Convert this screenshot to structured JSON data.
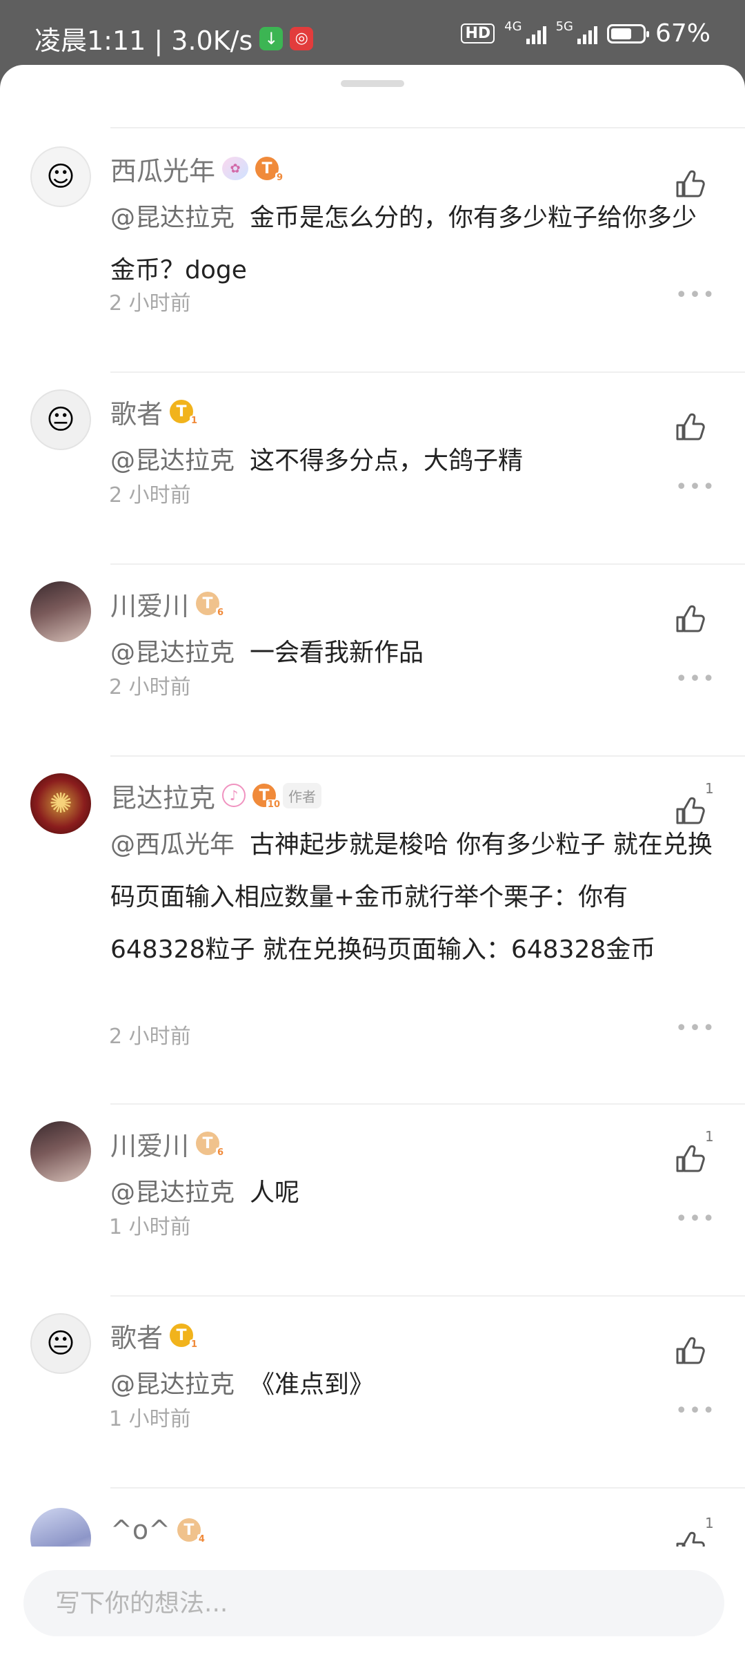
{
  "status_bar": {
    "time_speed": "凌晨1:11 | 3.0K/s",
    "hd_label": "HD",
    "net_4g": "4G",
    "net_5g": "5G",
    "battery": "67%",
    "battery_level": 0.67
  },
  "comments": [
    {
      "user": "西瓜光年",
      "level": "9",
      "mention": "@昆达拉克",
      "text": "金币是怎么分的，你有多少粒子给你多少金币？doge",
      "time": "2 小时前",
      "likes": ""
    },
    {
      "user": "歌者",
      "level": "1",
      "mention": "@昆达拉克",
      "text": "这不得多分点，大鸽子精",
      "time": "2 小时前",
      "likes": ""
    },
    {
      "user": "川爱川",
      "level": "6",
      "mention": "@昆达拉克",
      "text": "一会看我新作品",
      "time": "2 小时前",
      "likes": ""
    },
    {
      "user": "昆达拉克",
      "level": "10",
      "author_tag": "作者",
      "mention": "@西瓜光年",
      "text": "古神起步就是梭哈 你有多少粒子 就在兑换码页面输入相应数量+金币就行举个栗子：你有648328粒子 就在兑换码页面输入：648328金币",
      "time": "2 小时前",
      "likes": "1"
    },
    {
      "user": "川爱川",
      "level": "6",
      "mention": "@昆达拉克",
      "text": "人呢",
      "time": "1 小时前",
      "likes": "1"
    },
    {
      "user": "歌者",
      "level": "1",
      "mention": "@昆达拉克",
      "text": "《准点到》",
      "time": "1 小时前",
      "likes": ""
    },
    {
      "user": "^o^",
      "level": "4",
      "likes": "1"
    }
  ],
  "input": {
    "placeholder": "写下你的想法..."
  },
  "colors": {
    "sheet_bg": "#ffffff",
    "scrim": "#5f5f5f",
    "level_gold": "#f1b31c",
    "level_orange": "#f08a3a"
  }
}
